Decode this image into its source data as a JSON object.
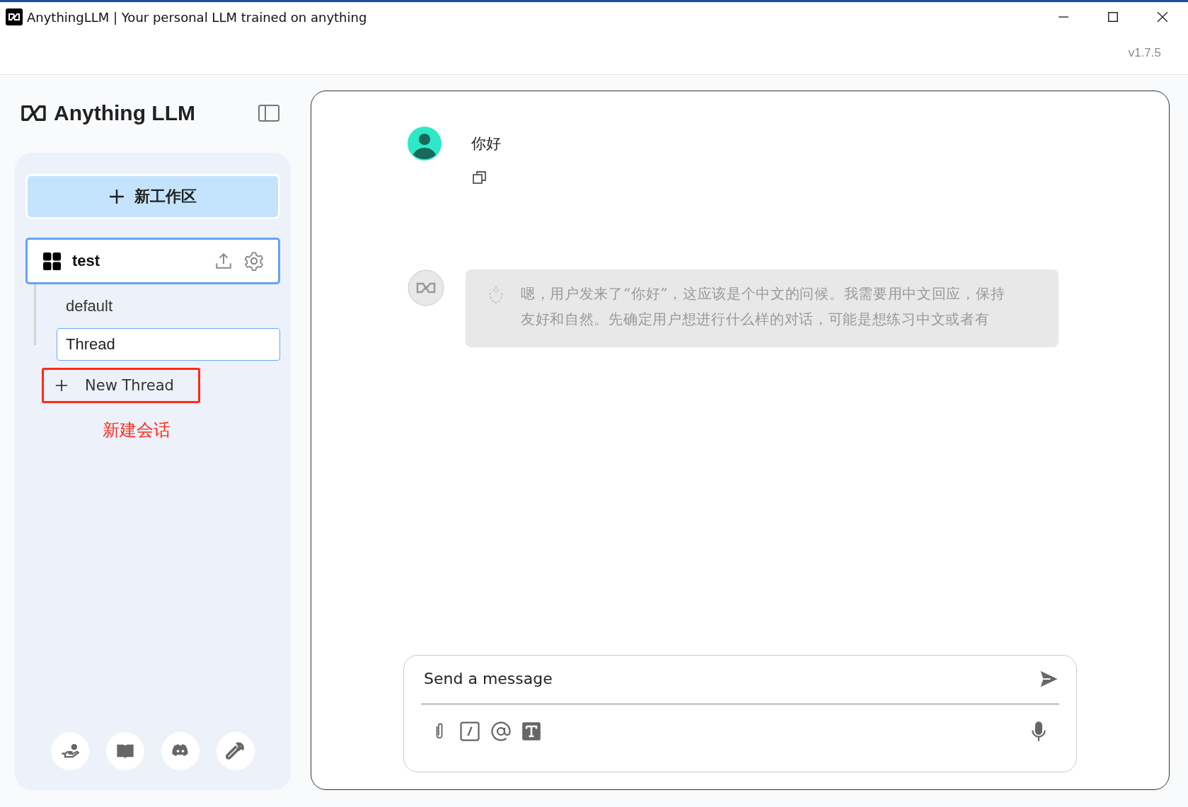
{
  "window": {
    "title": "AnythingLLM | Your personal LLM trained on anything",
    "version": "v1.7.5"
  },
  "sidebar": {
    "logo_text": "Anything LLM",
    "new_workspace_button": "新工作区",
    "workspaces": [
      {
        "name": "test",
        "selected": true,
        "threads": [
          {
            "name": "default",
            "selected": false
          },
          {
            "name": "Thread",
            "selected": true
          }
        ]
      }
    ],
    "new_thread_button": "New Thread",
    "annotation": "新建会话"
  },
  "chat": {
    "messages": [
      {
        "kind": "user",
        "text": "你好"
      },
      {
        "kind": "thinking",
        "text": "嗯，用户发来了“你好”，这应该是个中文的问候。我需要用中文回应，保持友好和自然。先确定用户想进行什么样的对话，可能是想练习中文或者有"
      }
    ],
    "input": {
      "placeholder": "Send a message"
    }
  }
}
